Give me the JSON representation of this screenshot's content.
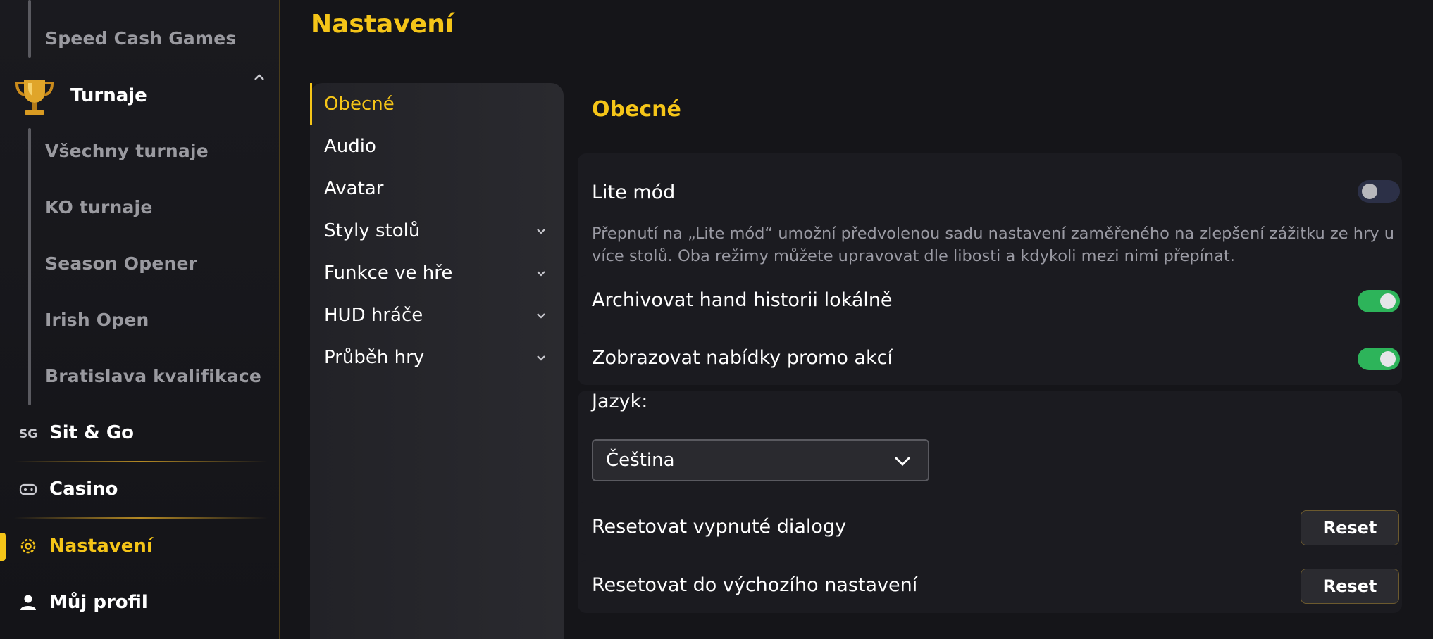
{
  "sidebar": {
    "poker_sub_items": [
      {
        "label": "Speed Cash Games"
      }
    ],
    "tournaments": {
      "label": "Turnaje",
      "sub_items": [
        {
          "label": "Všechny turnaje"
        },
        {
          "label": "KO turnaje"
        },
        {
          "label": "Season Opener"
        },
        {
          "label": "Irish Open"
        },
        {
          "label": "Bratislava kvalifikace"
        }
      ]
    },
    "items": [
      {
        "label": "Sit & Go",
        "icon": "sg-icon"
      },
      {
        "label": "Casino",
        "icon": "gamepad-icon"
      },
      {
        "label": "Nastavení",
        "icon": "gear-icon",
        "active": true
      },
      {
        "label": "Můj profil",
        "icon": "user-icon"
      }
    ]
  },
  "page": {
    "title": "Nastavení"
  },
  "settings_nav": [
    {
      "label": "Obecné",
      "active": true,
      "expandable": false
    },
    {
      "label": "Audio",
      "expandable": false
    },
    {
      "label": "Avatar",
      "expandable": false
    },
    {
      "label": "Styly stolů",
      "expandable": true
    },
    {
      "label": "Funkce ve hře",
      "expandable": true
    },
    {
      "label": "HUD hráče",
      "expandable": true
    },
    {
      "label": "Průběh hry",
      "expandable": true
    }
  ],
  "general": {
    "title": "Obecné",
    "lite_mode": {
      "label": "Lite mód",
      "enabled": false,
      "description": "Přepnutí na „Lite mód“ umožní předvolenou sadu nastavení zaměřeného na zlepšení zážitku ze hry u více stolů. Oba režimy můžete upravovat dle libosti a kdykoli mezi nimi přepínat."
    },
    "archive_hand_history": {
      "label": "Archivovat hand historii lokálně",
      "enabled": true
    },
    "show_promo": {
      "label": "Zobrazovat nabídky promo akcí",
      "enabled": true
    },
    "language": {
      "label": "Jazyk:",
      "value": "Čeština"
    },
    "reset_dialogs": {
      "label": "Resetovat vypnuté dialogy",
      "button": "Reset"
    },
    "reset_defaults": {
      "label": "Resetovat do výchozího nastavení",
      "button": "Reset"
    }
  },
  "colors": {
    "accent": "#f5c518",
    "toggle_on": "#2db45a",
    "toggle_off": "#2c3047",
    "background": "#151519"
  }
}
